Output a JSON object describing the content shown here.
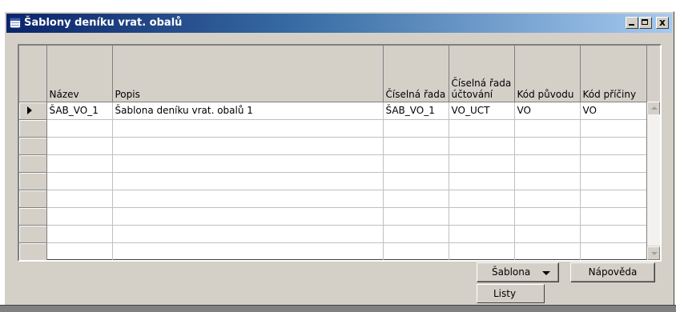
{
  "window": {
    "title": "Šablony deníku vrat. obalů",
    "close_glyph": "x"
  },
  "grid": {
    "columns": [
      {
        "key": "nazev",
        "label": "Název"
      },
      {
        "key": "popis",
        "label": "Popis"
      },
      {
        "key": "ciselna_rada",
        "label": "Číselná řada"
      },
      {
        "key": "ciselna_rada_uctovani",
        "label": "Číselná řada účtování"
      },
      {
        "key": "kod_puvodu",
        "label": "Kód původu"
      },
      {
        "key": "kod_priciny",
        "label": "Kód příčiny"
      }
    ],
    "rows": [
      {
        "nazev": "ŠAB_VO_1",
        "popis": "Šablona deníku vrat. obalů 1",
        "ciselna_rada": "ŠAB_VO_1",
        "ciselna_rada_uctovani": "VO_UCT",
        "kod_puvodu": "VO",
        "kod_priciny": "VO"
      }
    ],
    "empty_rows": 8
  },
  "buttons": {
    "template_label": "Šablona",
    "help_label": "Nápověda"
  },
  "menu": {
    "items": [
      "Listy"
    ]
  },
  "icons": {
    "window": "table-icon",
    "row_pointer": "row-pointer-icon",
    "dropdown": "chevron-down-icon"
  },
  "colors": {
    "title_gradient_start": "#0a246a",
    "title_gradient_end": "#a6caf0",
    "face": "#d4d0c8"
  }
}
